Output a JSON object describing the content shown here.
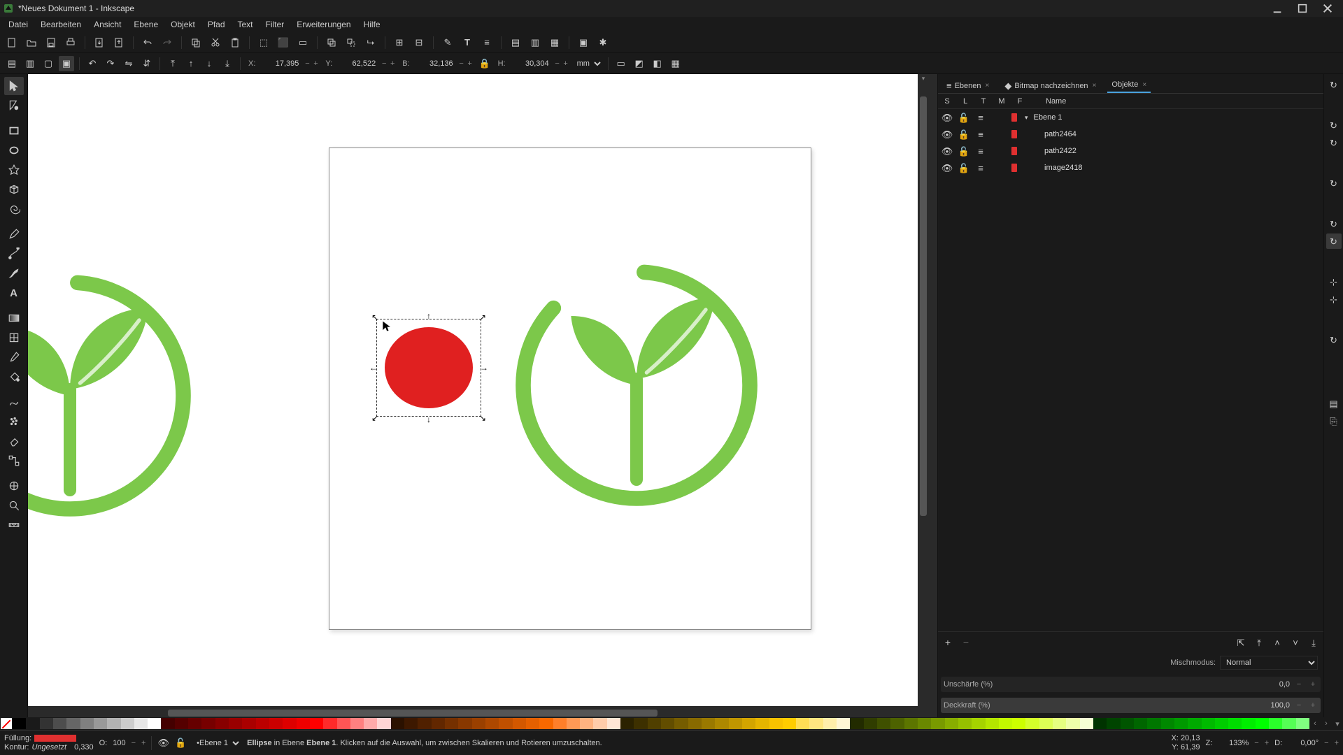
{
  "title": "*Neues Dokument 1 - Inkscape",
  "menu": [
    "Datei",
    "Bearbeiten",
    "Ansicht",
    "Ebene",
    "Objekt",
    "Pfad",
    "Text",
    "Filter",
    "Erweiterungen",
    "Hilfe"
  ],
  "coords": {
    "x_label": "X:",
    "x": "17,395",
    "y_label": "Y:",
    "y": "62,522",
    "w_label": "B:",
    "w": "32,136",
    "h_label": "H:",
    "h": "30,304",
    "unit": "mm"
  },
  "panels": {
    "tabs": [
      {
        "icon": "layers",
        "label": "Ebenen",
        "close": "×"
      },
      {
        "icon": "trace",
        "label": "Bitmap nachzeichnen",
        "close": "×"
      },
      {
        "icon": "",
        "label": "Objekte",
        "close": "×",
        "active": true
      }
    ],
    "header": {
      "s": "S",
      "l": "L",
      "t": "T",
      "m": "M",
      "f": "F",
      "name": "Name"
    }
  },
  "objects": [
    {
      "type": "layer",
      "name": "Ebene 1",
      "expanded": true
    },
    {
      "type": "item",
      "name": "path2464"
    },
    {
      "type": "item",
      "name": "path2422"
    },
    {
      "type": "item",
      "name": "image2418"
    }
  ],
  "blend": {
    "label": "Mischmodus:",
    "value": "Normal"
  },
  "blur": {
    "label": "Unschärfe (%)",
    "value": "0,0"
  },
  "opacity": {
    "label": "Deckkraft (%)",
    "value": "100,0"
  },
  "status": {
    "fill_label": "Füllung:",
    "stroke_label": "Kontur:",
    "stroke_value": "Ungesetzt",
    "stroke_width": "0,330",
    "opacity_label": "O:",
    "opacity_value": "100",
    "layer_prefix": "•",
    "layer": "Ebene 1",
    "sel_type": "Ellipse",
    "msg_in": " in Ebene ",
    "msg_layer": "Ebene 1",
    "msg_rest": ". Klicken auf die Auswahl, um zwischen Skalieren und Rotieren umzuschalten.",
    "x_label": "X:",
    "x": "20,13",
    "y_label": "Y:",
    "y": "61,39",
    "z_label": "Z:",
    "z": "133%",
    "d_label": "D:",
    "d": "0,00°"
  },
  "palette_colors": [
    "#000000",
    "#1a1a1a",
    "#333333",
    "#4d4d4d",
    "#666666",
    "#808080",
    "#999999",
    "#b3b3b3",
    "#cccccc",
    "#e6e6e6",
    "#ffffff",
    "#440000",
    "#550000",
    "#660000",
    "#770000",
    "#880000",
    "#990000",
    "#aa0000",
    "#bb0000",
    "#cc0000",
    "#dd0000",
    "#ee0000",
    "#ff0000",
    "#ff2a2a",
    "#ff5555",
    "#ff8080",
    "#ffaaaa",
    "#ffd5d5",
    "#2b1100",
    "#3d1800",
    "#502000",
    "#622700",
    "#753000",
    "#883800",
    "#9a4000",
    "#ad4800",
    "#c05000",
    "#d35800",
    "#e56000",
    "#f86800",
    "#ff7f2a",
    "#ff9955",
    "#ffb380",
    "#ffccaa",
    "#ffe6d5",
    "#2b2200",
    "#3d3000",
    "#503f00",
    "#624d00",
    "#755c00",
    "#886a00",
    "#9a7900",
    "#ad8800",
    "#c09600",
    "#d3a500",
    "#e5b400",
    "#f8c200",
    "#ffcc00",
    "#ffdd55",
    "#ffe680",
    "#ffeeaa",
    "#fff6d5",
    "#222b00",
    "#303d00",
    "#3f5000",
    "#4d6200",
    "#5c7500",
    "#6a8800",
    "#799a00",
    "#88ad00",
    "#96c000",
    "#a5d300",
    "#b4e500",
    "#c2f800",
    "#ccff00",
    "#d4ff2a",
    "#ddff55",
    "#e5ff80",
    "#eeffaa",
    "#f6ffd5",
    "#003300",
    "#004400",
    "#005500",
    "#006600",
    "#007700",
    "#008800",
    "#009900",
    "#00aa00",
    "#00bb00",
    "#00cc00",
    "#00dd00",
    "#00ee00",
    "#00ff00",
    "#2aff2a",
    "#55ff55",
    "#80ff80"
  ],
  "colors": {
    "red": "#e02020",
    "green": "#7cc84a"
  }
}
